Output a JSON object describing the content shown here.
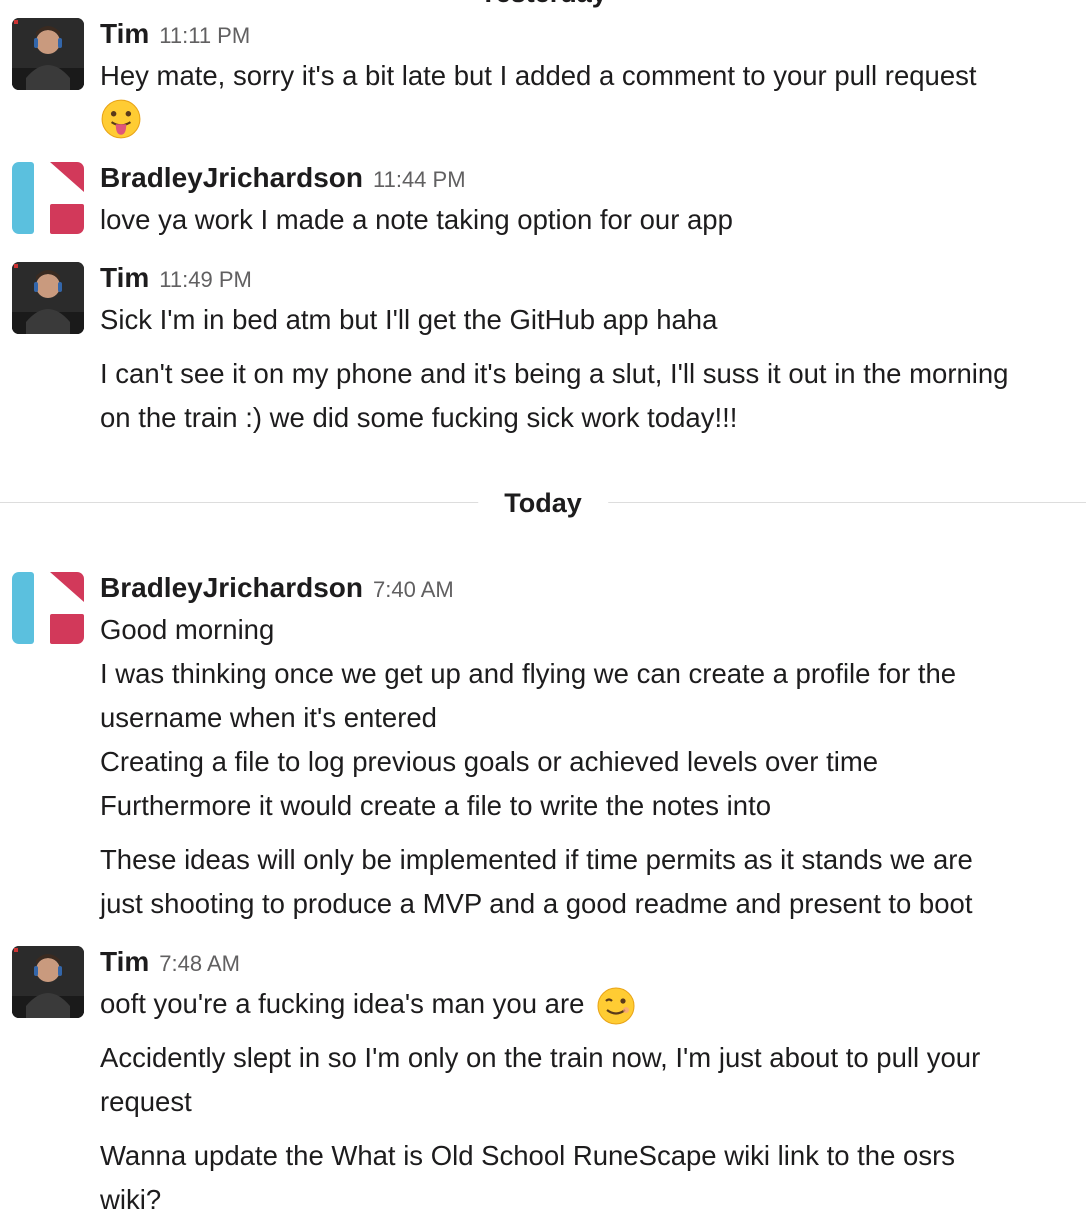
{
  "dividers": {
    "yesterday": "Yesterday",
    "today": "Today"
  },
  "messages": [
    {
      "sender": "Tim",
      "time": "11:11 PM",
      "lines": [
        "Hey mate, sorry it's a bit late but I added a comment to your pull request"
      ],
      "emoji": "tongue-out-emoji"
    },
    {
      "sender": "BradleyJrichardson",
      "time": "11:44 PM",
      "lines": [
        "love ya work I made a note taking option for our app"
      ]
    },
    {
      "sender": "Tim",
      "time": "11:49 PM",
      "lines": [
        "Sick I'm in bed atm but I'll get the GitHub app haha",
        "I can't see it on my phone and it's being a slut, I'll suss it out in the morning",
        "on the train :) we did some fucking sick work today!!!"
      ]
    },
    {
      "sender": "BradleyJrichardson",
      "time": "7:40 AM",
      "lines": [
        "Good morning",
        "I was thinking once we get up and flying we can create a profile for the",
        "username when it's entered",
        "Creating a file to log previous goals or achieved levels over time",
        "Furthermore it would create a file to write the notes into",
        "These ideas will only be implemented if time permits as it stands we are",
        "just shooting to produce a MVP and a good readme and present to boot"
      ]
    },
    {
      "sender": "Tim",
      "time": "7:48 AM",
      "lines": [
        "ooft you're a fucking idea's man you are",
        "Accidently slept in so I'm only on the train now, I'm just about to pull your",
        "request",
        "Wanna update the What is Old School RuneScape wiki link to the osrs",
        "wiki?"
      ],
      "emoji": "wink-emoji"
    }
  ],
  "colors": {
    "brad_avatar_blue": "#5bc0de",
    "brad_avatar_red": "#d2395a",
    "timestamp": "#616061",
    "divider": "#dddddd"
  }
}
